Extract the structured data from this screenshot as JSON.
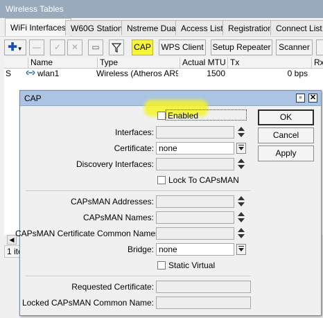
{
  "window": {
    "title": "Wireless Tables"
  },
  "tabs": [
    {
      "label": "WiFi Interfaces"
    },
    {
      "label": "W60G Station"
    },
    {
      "label": "Nstreme Dual"
    },
    {
      "label": "Access List"
    },
    {
      "label": "Registration"
    },
    {
      "label": "Connect List"
    }
  ],
  "toolbar": {
    "add_icon": "plus-icon",
    "cap_label": "CAP",
    "wps_label": "WPS Client",
    "setup_repeater_label": "Setup Repeater",
    "scanner_label": "Scanner",
    "highlight_color": "#f5f33a"
  },
  "table": {
    "columns": [
      "Name",
      "Type",
      "Actual MTU",
      "Tx",
      "Rx"
    ],
    "rows": [
      {
        "flag": "S",
        "name": "wlan1",
        "type": "Wireless (Atheros AR9...",
        "mtu": "1500",
        "tx": "0 bps"
      }
    ]
  },
  "status": {
    "count_label": "1 ite"
  },
  "dialog": {
    "title": "CAP",
    "enabled_label": "Enabled",
    "interfaces_label": "Interfaces:",
    "certificate_label": "Certificate:",
    "certificate_value": "none",
    "discovery_label": "Discovery Interfaces:",
    "lock_label": "Lock To CAPsMAN",
    "capsman_addresses_label": "CAPsMAN Addresses:",
    "capsman_names_label": "CAPsMAN Names:",
    "capsman_cert_label": "CAPsMAN Certificate Common Names:",
    "bridge_label": "Bridge:",
    "bridge_value": "none",
    "static_virtual_label": "Static Virtual",
    "requested_cert_label": "Requested Certificate:",
    "locked_cn_label": "Locked CAPsMAN Common Name:",
    "ok_label": "OK",
    "cancel_label": "Cancel",
    "apply_label": "Apply"
  }
}
